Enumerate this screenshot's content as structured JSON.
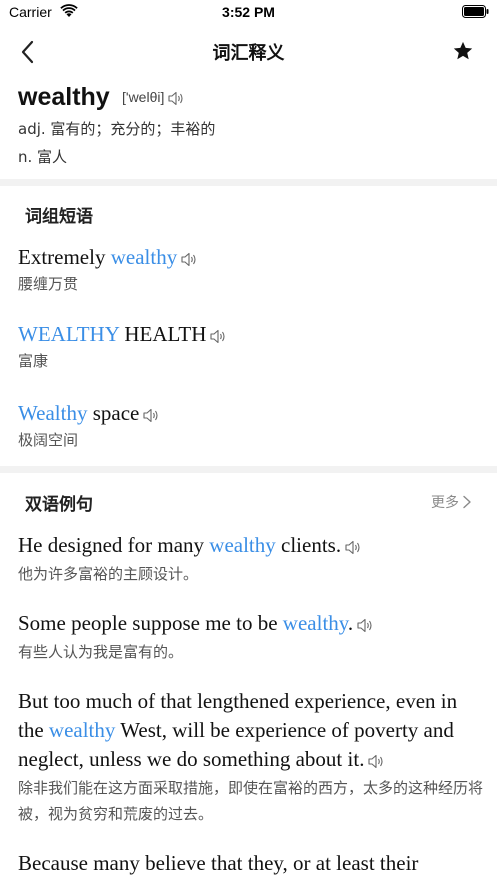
{
  "status": {
    "carrier": "Carrier",
    "time": "3:52 PM"
  },
  "nav": {
    "title": "词汇释义"
  },
  "word": {
    "headword": "wealthy",
    "phonetic": "['welθi]",
    "definitions": [
      "adj. 富有的；充分的；丰裕的",
      "n. 富人"
    ]
  },
  "phrases": {
    "title": "词组短语",
    "items": [
      {
        "pre": "Extremely ",
        "hl": "wealthy",
        "post": "",
        "zh": "腰缠万贯"
      },
      {
        "pre": "",
        "hl": "WEALTHY",
        "post": " HEALTH",
        "zh": "富康"
      },
      {
        "pre": "",
        "hl": "Wealthy",
        "post": " space",
        "zh": "极阔空间"
      }
    ]
  },
  "examples": {
    "title": "双语例句",
    "more": "更多",
    "items": [
      {
        "pre": "He designed for many ",
        "hl": "wealthy",
        "post": " clients.",
        "zh": "他为许多富裕的主顾设计。"
      },
      {
        "pre": "Some people suppose me to be ",
        "hl": "wealthy",
        "post": ".",
        "zh": "有些人认为我是富有的。"
      },
      {
        "pre": "But too much of that lengthened experience, even in the ",
        "hl": "wealthy",
        "post": " West, will be experience of poverty and neglect, unless we do something about it.",
        "zh": "除非我们能在这方面采取措施，即使在富裕的西方，太多的这种经历将被，视为贫穷和荒废的过去。"
      },
      {
        "pre": "Because many believe that they, or at least their",
        "hl": "",
        "post": "",
        "zh": ""
      }
    ]
  },
  "colors": {
    "highlight": "#3a8ee6",
    "divider": "#f2f2f2"
  },
  "icons": {
    "back": "chevron-left-icon",
    "favorite": "star-icon",
    "audio": "speaker-icon",
    "more": "chevron-right-icon"
  }
}
